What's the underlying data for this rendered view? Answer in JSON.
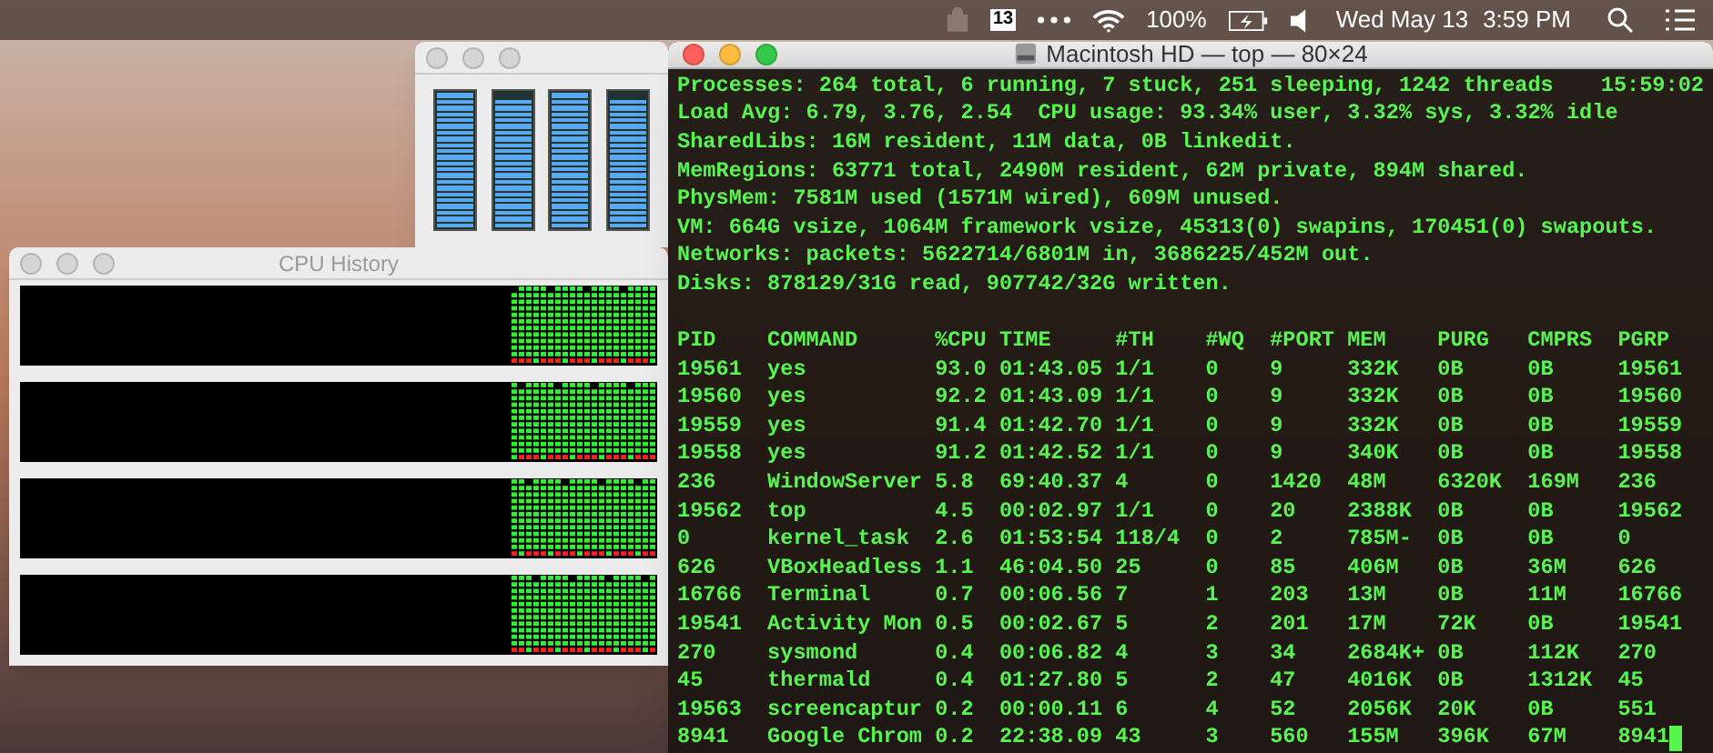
{
  "menu_bar": {
    "calendar_day": "13",
    "battery": "100%",
    "date": "Wed May 13",
    "time": "3:59 PM"
  },
  "cpu_usage_window": {
    "meters": [
      {
        "level": 1
      },
      {
        "level": 0.94
      },
      {
        "level": 1
      },
      {
        "level": 0.94
      }
    ]
  },
  "cpu_history_window": {
    "title": "CPU History",
    "graphs": [
      {
        "kind": "history"
      },
      {
        "kind": "history"
      },
      {
        "kind": "history"
      },
      {
        "kind": "history"
      }
    ]
  },
  "terminal": {
    "title": "Macintosh HD — top — 80×24",
    "summary": [
      "Processes: 264 total, 6 running, 7 stuck, 251 sleeping, 1242 threads",
      "Load Avg: 6.79, 3.76, 2.54  CPU usage: 93.34% user, 3.32% sys, 3.32% idle",
      "SharedLibs: 16M resident, 11M data, 0B linkedit.",
      "MemRegions: 63771 total, 2490M resident, 62M private, 894M shared.",
      "PhysMem: 7581M used (1571M wired), 609M unused.",
      "VM: 664G vsize, 1064M framework vsize, 45313(0) swapins, 170451(0) swapouts.",
      "Networks: packets: 5622714/6801M in, 3686225/452M out.",
      "Disks: 878129/31G read, 907742/32G written."
    ],
    "clock": "15:59:02",
    "columns": [
      "PID",
      "COMMAND",
      "%CPU",
      "TIME",
      "#TH",
      "#WQ",
      "#PORT",
      "MEM",
      "PURG",
      "CMPRS",
      "PGRP"
    ],
    "rows": [
      [
        "19561",
        "yes",
        "93.0",
        "01:43.05",
        "1/1",
        "0",
        "9",
        "332K",
        "0B",
        "0B",
        "19561"
      ],
      [
        "19560",
        "yes",
        "92.2",
        "01:43.09",
        "1/1",
        "0",
        "9",
        "332K",
        "0B",
        "0B",
        "19560"
      ],
      [
        "19559",
        "yes",
        "91.4",
        "01:42.70",
        "1/1",
        "0",
        "9",
        "332K",
        "0B",
        "0B",
        "19559"
      ],
      [
        "19558",
        "yes",
        "91.2",
        "01:42.52",
        "1/1",
        "0",
        "9",
        "340K",
        "0B",
        "0B",
        "19558"
      ],
      [
        "236",
        "WindowServer",
        "5.8",
        "69:40.37",
        "4",
        "0",
        "1420",
        "48M",
        "6320K",
        "169M",
        "236"
      ],
      [
        "19562",
        "top",
        "4.5",
        "00:02.97",
        "1/1",
        "0",
        "20",
        "2388K",
        "0B",
        "0B",
        "19562"
      ],
      [
        "0",
        "kernel_task",
        "2.6",
        "01:53:54",
        "118/4",
        "0",
        "2",
        "785M-",
        "0B",
        "0B",
        "0"
      ],
      [
        "626",
        "VBoxHeadless",
        "1.1",
        "46:04.50",
        "25",
        "0",
        "85",
        "406M",
        "0B",
        "36M",
        "626"
      ],
      [
        "16766",
        "Terminal",
        "0.7",
        "00:06.56",
        "7",
        "1",
        "203",
        "13M",
        "0B",
        "11M",
        "16766"
      ],
      [
        "19541",
        "Activity Mon",
        "0.5",
        "00:02.67",
        "5",
        "2",
        "201",
        "17M",
        "72K",
        "0B",
        "19541"
      ],
      [
        "270",
        "sysmond",
        "0.4",
        "00:06.82",
        "4",
        "3",
        "34",
        "2684K+",
        "0B",
        "112K",
        "270"
      ],
      [
        "45",
        "thermald",
        "0.4",
        "01:27.80",
        "5",
        "2",
        "47",
        "4016K",
        "0B",
        "1312K",
        "45"
      ],
      [
        "19563",
        "screencaptur",
        "0.2",
        "00:00.11",
        "6",
        "4",
        "52",
        "2056K",
        "20K",
        "0B",
        "551"
      ],
      [
        "8941",
        "Google Chrom",
        "0.2",
        "22:38.09",
        "43",
        "3",
        "560",
        "155M",
        "396K",
        "67M",
        "8941"
      ]
    ]
  }
}
